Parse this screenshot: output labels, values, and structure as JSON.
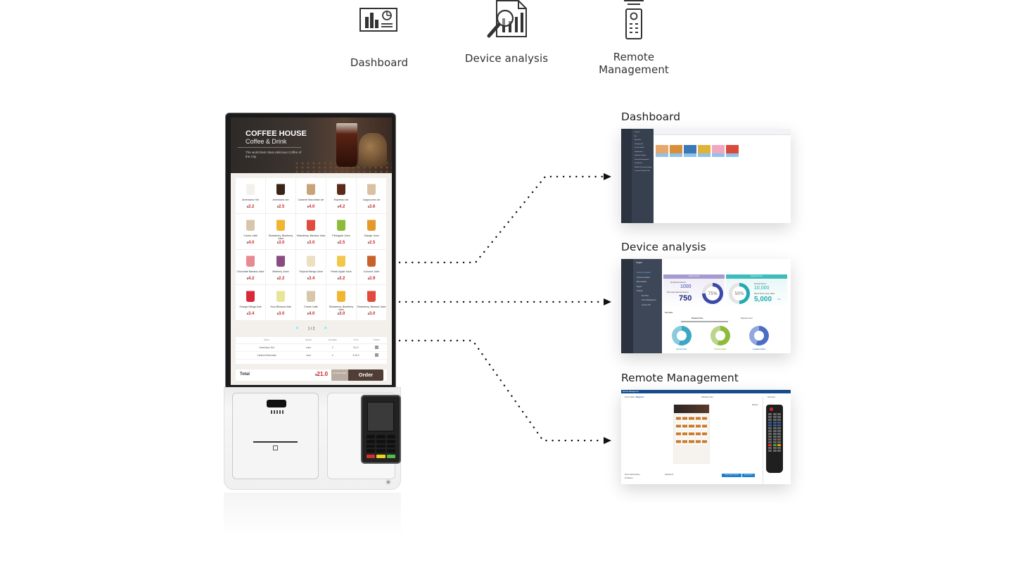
{
  "features": [
    {
      "icon": "dashboard-icon",
      "label": "Dashboard"
    },
    {
      "icon": "device-analysis-icon",
      "label": "Device analysis"
    },
    {
      "icon": "remote-control-icon",
      "label": "Remote Management"
    }
  ],
  "kiosk": {
    "hero": {
      "title": "COFFEE HOUSE",
      "subtitle": "Coffee & Drink",
      "tagline": "The world best class delicious Coffee of the City"
    },
    "menu_items": [
      {
        "name": "Americano Hot",
        "price": "2.2",
        "color": "#f4f1ec"
      },
      {
        "name": "Americano Ice",
        "price": "2.5",
        "color": "#3a2418"
      },
      {
        "name": "Caramel Macchiato Ice",
        "price": "4.0",
        "color": "#c8a47a"
      },
      {
        "name": "Espresso Ice",
        "price": "4.2",
        "color": "#5b2a1a"
      },
      {
        "name": "Cappuccino Ice",
        "price": "3.6",
        "color": "#d9c2a3"
      },
      {
        "name": "Cream Latte",
        "price": "4.0",
        "color": "#d8c6ac"
      },
      {
        "name": "Strawberry, Blueberry Juice",
        "price": "3.0",
        "color": "#f1b532"
      },
      {
        "name": "Strawberry, Banana Juice",
        "price": "3.0",
        "color": "#e24a3b"
      },
      {
        "name": "Pineapple Juice",
        "price": "2.5",
        "color": "#8dbb3a"
      },
      {
        "name": "Orange Juice",
        "price": "2.5",
        "color": "#e49a2a"
      },
      {
        "name": "Chocolate Banana Juice",
        "price": "4.2",
        "color": "#e88a92"
      },
      {
        "name": "Mulberry Juice",
        "price": "2.2",
        "color": "#8a4c80"
      },
      {
        "name": "Tropical Mango Juice",
        "price": "3.4",
        "color": "#ece0c0"
      },
      {
        "name": "Peach Apple Juice",
        "price": "3.2",
        "color": "#f2c84a"
      },
      {
        "name": "Coconut Juice",
        "price": "2.9",
        "color": "#c8622a"
      },
      {
        "name": "Orange Mango Ade",
        "price": "3.4",
        "color": "#d8283a"
      },
      {
        "name": "Yuzu Blossom Ade",
        "price": "3.0",
        "color": "#e8e49a"
      },
      {
        "name": "Cream Latte",
        "price": "4.0",
        "color": "#d8c6ac"
      },
      {
        "name": "Strawberry, Blueberry Juice",
        "price": "3.0",
        "color": "#f1b532"
      },
      {
        "name": "Strawberry, Banana Juice",
        "price": "3.0",
        "color": "#e24a3b"
      }
    ],
    "currency": "$",
    "pager": {
      "prev": "<",
      "label": "1 / 2",
      "next": ">"
    },
    "order_table": {
      "headers": [
        "Menu",
        "Option",
        "Quantity",
        "Price",
        "Delete"
      ],
      "rows": [
        [
          "Americano Hot",
          "none",
          "2",
          "$ 4.4",
          ""
        ],
        [
          "Caramel Macchiato",
          "none",
          "4",
          "$ 16.0",
          ""
        ]
      ]
    },
    "total_label": "Total",
    "total_value": "21.0",
    "all_clear_label": "All Clear Delete",
    "order_label": "Order"
  },
  "previews": {
    "dashboard": {
      "title": "Dashboard",
      "sidebar_items": [
        "Devices",
        "All",
        "By Status",
        "Unapproved",
        "Device Health",
        "Notifications",
        "Software Update",
        "Shared Management",
        "Dashboard",
        "All With Security Settings",
        "Compare Network Tab"
      ],
      "thumb_colors": [
        "#e8a66a",
        "#d98e3a",
        "#3a78b8",
        "#e0b23a",
        "#f0a8c0",
        "#d84a3a"
      ]
    },
    "device_analysis": {
      "title": "Device analysis",
      "app_name": "Insight",
      "menu": [
        "Operation analysis",
        "Contents Analysis",
        "Play Analysis",
        "Report",
        "Settings",
        "Set Index",
        "Index Management",
        "License Info"
      ],
      "card1": {
        "header": "Device Count",
        "label1": "All approved devices",
        "value1": "1000",
        "label2": "Play-ready approved devices",
        "value2": "750",
        "percent": 75,
        "color": "#3b4aa8"
      },
      "card2": {
        "header": "Playback Time",
        "label1": "Running Screen",
        "value1": "10,000",
        "label2": "Played Screen (Avg. Value)",
        "value2": "5,000",
        "unit": "Hour",
        "percent": 50,
        "color": "#22aab0"
      },
      "key_index_label": "Key Index",
      "tabs": [
        "Playback Time",
        "Playback Count"
      ],
      "indices": [
        {
          "label": "Brand Index",
          "color": "#3aa7c4"
        },
        {
          "label": "Product Index",
          "color": "#8dbb3a"
        },
        {
          "label": "Location Index",
          "color": "#4a6ec4"
        }
      ]
    },
    "remote_management": {
      "title": "Remote Management",
      "bar_title": "Remote Management",
      "device_name_label": "Device Name :",
      "device_name": "Magicinfo",
      "schedule_label": "Schedule name :",
      "refresh_label": "Refresh",
      "model_label": "Device Model Name :",
      "ip_label": "IP Address :",
      "mac_label": "Network ID :",
      "button1": "Start Remote Control",
      "button2": "Stop Remote Control",
      "document_label": "Document",
      "mini_title": "COFFEE HOUSE"
    }
  }
}
